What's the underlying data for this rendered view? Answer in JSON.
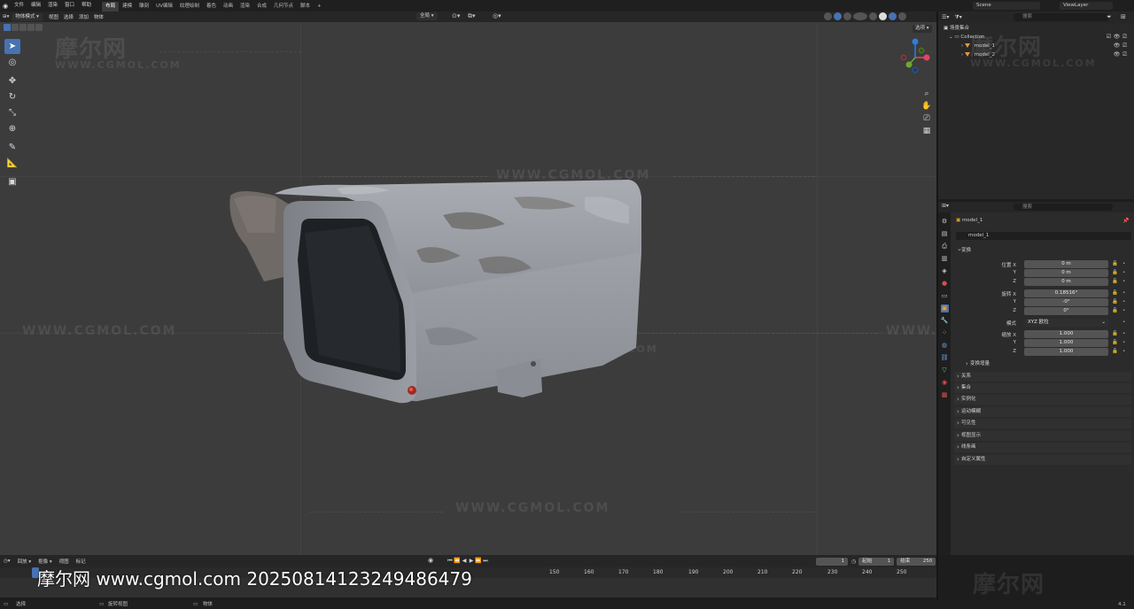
{
  "app": {
    "menu": [
      "文件",
      "编辑",
      "渲染",
      "窗口",
      "帮助"
    ],
    "workspaces": [
      "布局",
      "建模",
      "雕刻",
      "UV编辑",
      "纹理绘制",
      "着色",
      "动画",
      "渲染",
      "合成",
      "几何节点",
      "脚本"
    ],
    "active_workspace": "布局",
    "add_workspace": "+",
    "scene_name": "Scene",
    "view_layer": "ViewLayer"
  },
  "viewport": {
    "mode": "物体模式",
    "header_menus": [
      "视图",
      "选择",
      "添加",
      "物体"
    ],
    "transform_orientation": "全局",
    "options_label": "选项"
  },
  "watermarks": {
    "logo_cn": "摩尔网",
    "url": "WWW.CGMOL.COM"
  },
  "outliner": {
    "search_placeholder": "搜索",
    "scene_collection": "场景集合",
    "collection": "Collection",
    "objects": [
      {
        "name": "model_1",
        "selected": true
      },
      {
        "name": "model_2",
        "selected": false
      }
    ]
  },
  "properties": {
    "search_placeholder": "搜索",
    "object_name": "model_1",
    "object_field": "model_1",
    "transform_panel": "变换",
    "location_label": "位置 X",
    "rotation_label": "旋转 X",
    "scale_label": "缩放 X",
    "mode_label": "模式",
    "mode_value": "XYZ 欧拉",
    "axis_y": "Y",
    "axis_z": "Z",
    "location": [
      "0 m",
      "0 m",
      "0 m"
    ],
    "rotation": [
      "0.18516°",
      "-0°",
      "0°"
    ],
    "scale": [
      "1.000",
      "1.000",
      "1.000"
    ],
    "delta_transform": "变换增量",
    "panels": [
      "关系",
      "集合",
      "实例化",
      "运动模糊",
      "可见性",
      "视图显示",
      "线条画",
      "自定义属性"
    ]
  },
  "timeline": {
    "header_menus": [
      "回放",
      "抠像",
      "视图",
      "标记"
    ],
    "current_frame": "1",
    "start_label": "起始",
    "start_value": "1",
    "end_label": "结束",
    "end_value": "250",
    "frames": [
      "150",
      "160",
      "170",
      "180",
      "190",
      "200",
      "210",
      "220",
      "230",
      "240",
      "250"
    ]
  },
  "statusbar": {
    "left": "选择",
    "middle": "旋转视图",
    "right": "物体",
    "version": "4.1"
  },
  "overlay": {
    "text": "摩尔网 www.cgmol.com 20250814123249486479"
  }
}
